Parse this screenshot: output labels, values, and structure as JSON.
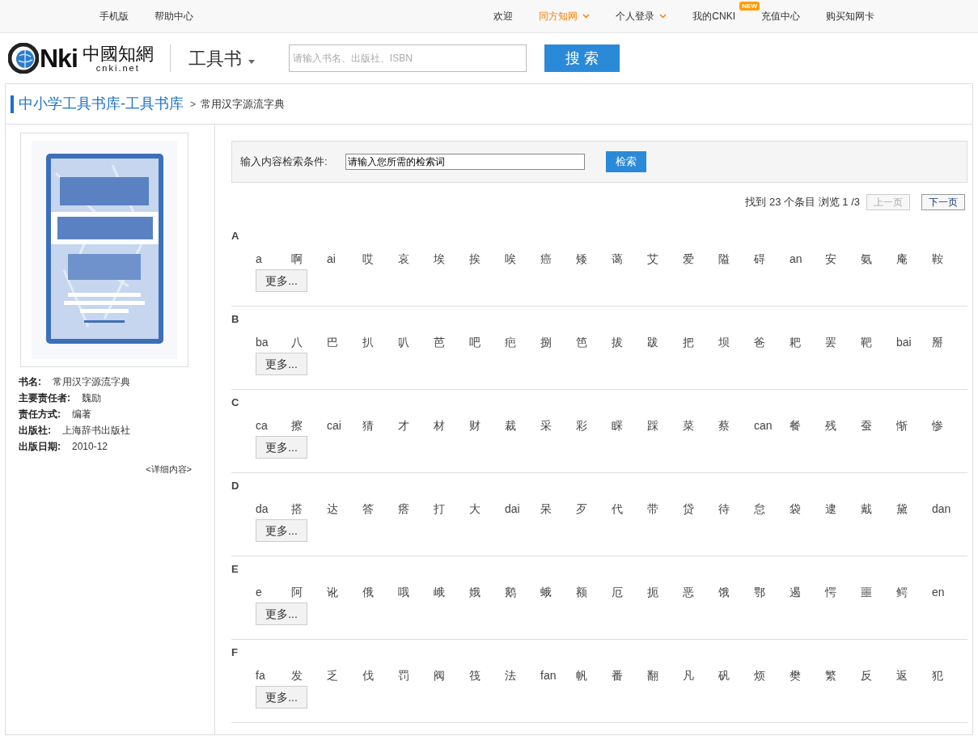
{
  "top_bar": {
    "left_links": [
      "手机版",
      "帮助中心"
    ],
    "right_links": [
      {
        "label": "欢迎",
        "highlight": false,
        "caret": false
      },
      {
        "label": "同方知网",
        "highlight": true,
        "caret": true
      },
      {
        "label": "个人登录",
        "highlight": false,
        "caret": true
      },
      {
        "label": "我的CNKI",
        "highlight": false,
        "caret": false,
        "badge": "NEW"
      },
      {
        "label": "充值中心",
        "highlight": false,
        "caret": false
      },
      {
        "label": "购买知网卡",
        "highlight": false,
        "caret": false
      }
    ]
  },
  "header": {
    "logo": {
      "letters": "Nki",
      "chinese": "中國知網",
      "domain": "cnki.net"
    },
    "category": "工具书",
    "search": {
      "placeholder": "请输入书名、出版社、ISBN"
    },
    "search_button": "搜 索"
  },
  "breadcrumb": {
    "library": "中小学工具书库-工具书库",
    "separator": ">",
    "current": "常用汉字源流字典"
  },
  "book": {
    "fields": [
      {
        "label": "书名:",
        "value": "常用汉字源流字典"
      },
      {
        "label": "主要责任者:",
        "value": "魏励"
      },
      {
        "label": "责任方式:",
        "value": "编著"
      },
      {
        "label": "出版社:",
        "value": "上海辞书出版社"
      },
      {
        "label": "出版日期:",
        "value": "2010-12"
      }
    ],
    "detail_link": "<详细内容>"
  },
  "content_search": {
    "label": "输入内容检索条件:",
    "value": "请输入您所需的检索词",
    "button": "检索"
  },
  "pagination": {
    "summary": "找到 23 个条目 浏览 1 /3",
    "prev": {
      "label": "上一页",
      "disabled": true
    },
    "next": {
      "label": "下一页",
      "disabled": false
    }
  },
  "sections": [
    {
      "letter": "A",
      "items": [
        "a",
        "啊",
        "ai",
        "哎",
        "哀",
        "埃",
        "挨",
        "唉",
        "癌",
        "矮",
        "蔼",
        "艾",
        "爱",
        "隘",
        "碍",
        "an",
        "安",
        "氨",
        "庵",
        "鞍"
      ],
      "more": "更多..."
    },
    {
      "letter": "B",
      "items": [
        "ba",
        "八",
        "巴",
        "扒",
        "叭",
        "芭",
        "吧",
        "疤",
        "捌",
        "笆",
        "拔",
        "跋",
        "把",
        "坝",
        "爸",
        "耙",
        "罢",
        "靶",
        "bai",
        "掰"
      ],
      "more": "更多..."
    },
    {
      "letter": "C",
      "items": [
        "ca",
        "擦",
        "cai",
        "猜",
        "才",
        "材",
        "财",
        "裁",
        "采",
        "彩",
        "睬",
        "踩",
        "菜",
        "蔡",
        "can",
        "餐",
        "残",
        "蚕",
        "惭",
        "惨"
      ],
      "more": "更多..."
    },
    {
      "letter": "D",
      "items": [
        "da",
        "搭",
        "达",
        "答",
        "瘩",
        "打",
        "大",
        "dai",
        "呆",
        "歹",
        "代",
        "带",
        "贷",
        "待",
        "怠",
        "袋",
        "逮",
        "戴",
        "黛",
        "dan"
      ],
      "more": "更多..."
    },
    {
      "letter": "E",
      "items": [
        "e",
        "阿",
        "讹",
        "俄",
        "哦",
        "峨",
        "娥",
        "鹅",
        "蛾",
        "额",
        "厄",
        "扼",
        "恶",
        "饿",
        "鄂",
        "遏",
        "愕",
        "噩",
        "鳄",
        "en"
      ],
      "more": "更多..."
    },
    {
      "letter": "F",
      "items": [
        "fa",
        "发",
        "乏",
        "伐",
        "罚",
        "阀",
        "筏",
        "法",
        "fan",
        "帆",
        "番",
        "翻",
        "凡",
        "矾",
        "烦",
        "樊",
        "繁",
        "反",
        "返",
        "犯"
      ],
      "more": "更多..."
    }
  ]
}
